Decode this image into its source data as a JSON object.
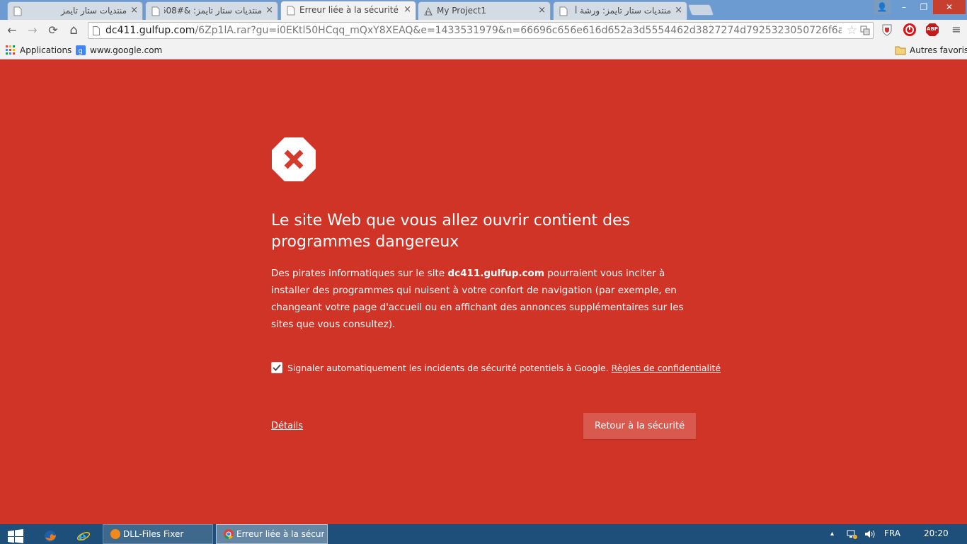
{
  "colors": {
    "danger_background": "#cf3427",
    "button_background": "#d9594f",
    "tab_strip": "#6b9bd1",
    "taskbar": "#1d4f7a"
  },
  "tabs": [
    {
      "title": "منتديات ستار تايمز",
      "close": "×",
      "icon": "page-icon",
      "rtl": true,
      "active": false
    },
    {
      "title": "منتديات ستار تايمز: &#608",
      "close": "×",
      "icon": "page-icon",
      "rtl": true,
      "active": false
    },
    {
      "title": "Erreur liée à la sécurité",
      "close": "×",
      "icon": "page-icon",
      "rtl": false,
      "active": true
    },
    {
      "title": "My Project1",
      "close": "×",
      "icon": "project-icon",
      "rtl": false,
      "active": false
    },
    {
      "title": "منتديات ستار تايمز: ورشة أ",
      "close": "×",
      "icon": "page-icon",
      "rtl": true,
      "active": false
    }
  ],
  "window_controls": {
    "user": "👤",
    "minimize": "–",
    "restore": "❐",
    "close": "✕"
  },
  "toolbar": {
    "back": "←",
    "forward": "→",
    "reload": "⟳",
    "home": "⌂",
    "url_host": "dc411.gulfup.com",
    "url_path": "/6Zp1lA.rar?gu=i0EKtl50HCqq_mQxY8XEAQ&e=1433531979&n=66696c656e616d652a3d5554462d3827274d7925323050726f6a6",
    "star": "☆",
    "menu": "≡",
    "abp_label": "ABP"
  },
  "bookmarks": {
    "apps_label": "Applications",
    "google_label": "www.google.com",
    "other_label": "Autres favoris"
  },
  "interstitial": {
    "heading": "Le site Web que vous allez ouvrir contient des programmes dangereux",
    "body_before": "Des pirates informatiques sur le site ",
    "body_host": "dc411.gulfup.com",
    "body_after": " pourraient vous inciter à installer des programmes qui nuisent à votre confort de navigation (par exemple, en changeant votre page d'accueil ou en affichant des annonces supplémentaires sur les sites que vous consultez).",
    "report_checked": true,
    "report_text": "Signaler automatiquement les incidents de sécurité potentiels à Google. ",
    "report_link": "Règles de confidentialité",
    "details_link": "Détails",
    "back_button": "Retour à la sécurité"
  },
  "taskbar": {
    "tasks": [
      {
        "label": "DLL-Files Fixer",
        "active": false
      },
      {
        "label": "Erreur liée à la sécurit...",
        "active": true
      }
    ],
    "tray_arrow": "▴",
    "language": "FRA",
    "clock": "20:20"
  }
}
